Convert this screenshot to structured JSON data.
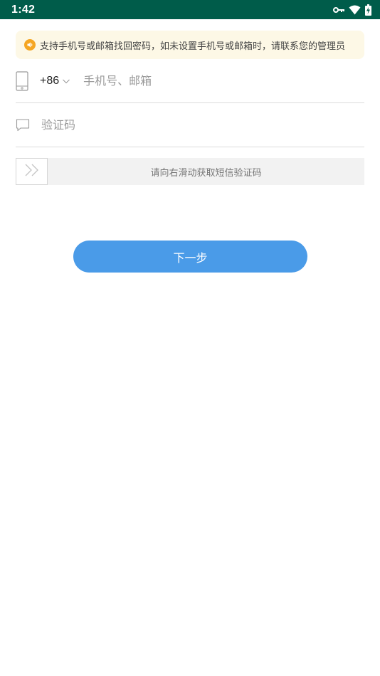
{
  "status_bar": {
    "time": "1:42",
    "icons": [
      "vpn-key-icon",
      "wifi-icon",
      "battery-charging-icon"
    ],
    "background": "#005c4a"
  },
  "notice": {
    "icon": "speaker-icon",
    "text": "支持手机号或邮箱找回密码，如未设置手机号或邮箱时，请联系您的管理员",
    "background": "#fdf8e6",
    "icon_color": "#f5a623"
  },
  "phone_row": {
    "icon": "phone-icon",
    "country_code": "+86",
    "placeholder": "手机号、邮箱"
  },
  "code_row": {
    "icon": "message-icon",
    "placeholder": "验证码"
  },
  "slider": {
    "icon": "double-chevron-right-icon",
    "text": "请向右滑动获取短信验证码"
  },
  "next_button": {
    "label": "下一步",
    "color": "#4a9be8"
  }
}
